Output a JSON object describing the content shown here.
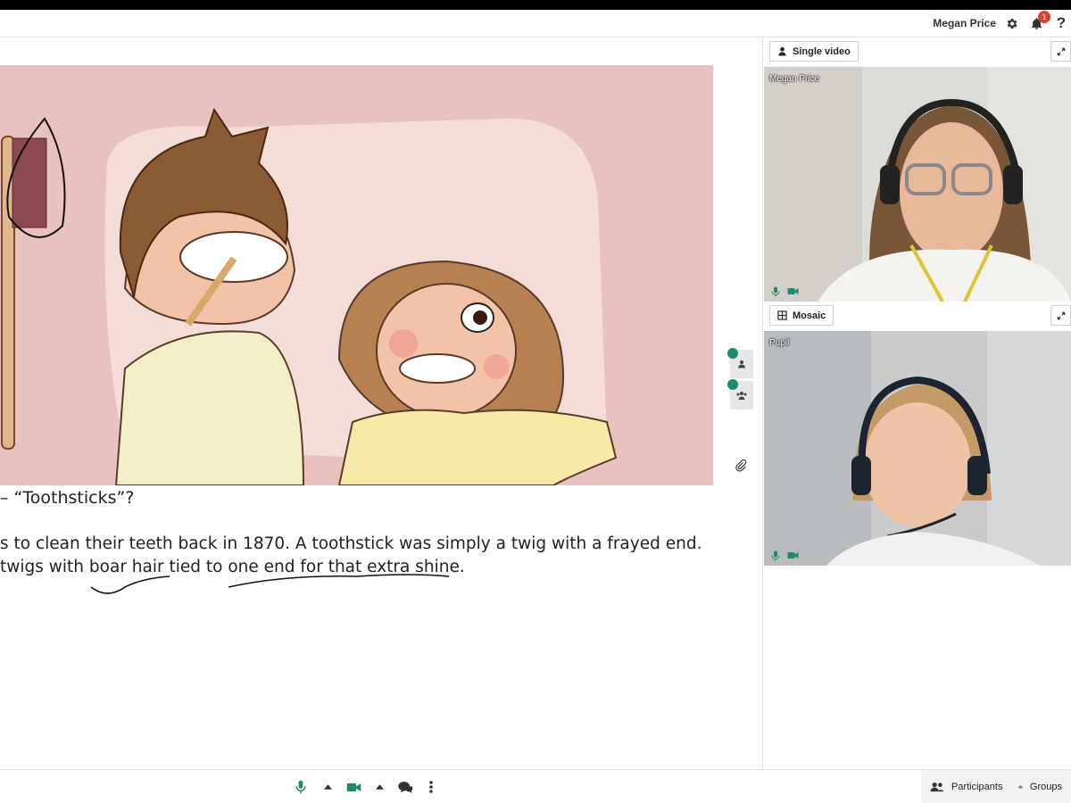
{
  "topbar": {
    "user_name": "Megan Price",
    "notification_count": "1",
    "icons": [
      "settings-gear-icon",
      "notification-bell-icon",
      "help-question-icon"
    ]
  },
  "slide": {
    "heading": "– “Toothsticks”?",
    "line1": "s to clean their teeth back in 1870. A toothstick was simply a twig with a frayed end.",
    "line2": " twigs with boar hair tied to one end for that extra shine."
  },
  "side_tools": [
    "single-participant-icon",
    "group-participants-icon",
    "attachment-paperclip-icon"
  ],
  "video_panel": {
    "single_label": "Single video",
    "mosaic_label": "Mosaic",
    "teacher_name": "Megan Price",
    "pupil_name": "Pupil"
  },
  "bottombar": {
    "participants_label": "Participants",
    "groups_label": "Groups",
    "icons": [
      "microphone-icon",
      "camera-icon",
      "chat-icon",
      "more-options-icon"
    ]
  },
  "colors": {
    "accent": "#1f8a70",
    "notification": "#d9432f",
    "slide_background": "#e8c2bf"
  }
}
